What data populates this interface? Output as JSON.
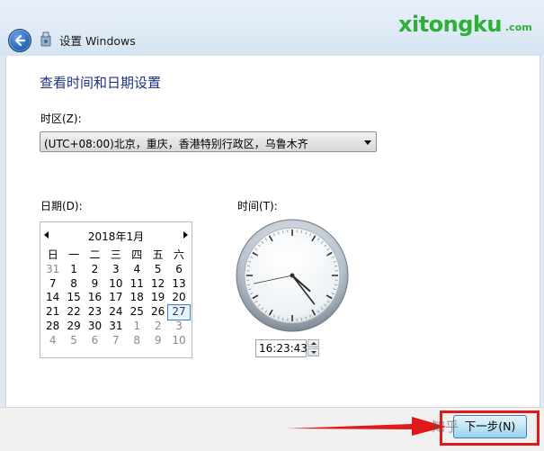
{
  "window": {
    "title": "设置 Windows"
  },
  "brand": {
    "name": "xitongku",
    "suffix": ".com",
    "color": "#2fae3a"
  },
  "main": {
    "heading": "查看时间和日期设置",
    "timezone": {
      "label": "时区(Z):",
      "value": "(UTC+08:00)北京，重庆，香港特别行政区，乌鲁木齐"
    },
    "date_label": "日期(D):",
    "time_label": "时间(T):",
    "calendar": {
      "month": "2018年1月",
      "weekdays": [
        "日",
        "一",
        "二",
        "三",
        "四",
        "五",
        "六"
      ],
      "weeks": [
        [
          "31",
          "1",
          "2",
          "3",
          "4",
          "5",
          "6"
        ],
        [
          "7",
          "8",
          "9",
          "10",
          "11",
          "12",
          "13"
        ],
        [
          "14",
          "15",
          "16",
          "17",
          "18",
          "19",
          "20"
        ],
        [
          "21",
          "22",
          "23",
          "24",
          "25",
          "26",
          "27"
        ],
        [
          "28",
          "29",
          "30",
          "31",
          "1",
          "2",
          "3"
        ],
        [
          "4",
          "5",
          "6",
          "7",
          "8",
          "9",
          "10"
        ]
      ],
      "selected_day": "27"
    },
    "time_value": "16:23:43"
  },
  "footer": {
    "next_button": "下一步(N)",
    "watermark": "知乎"
  },
  "colors": {
    "accent": "#1e3287",
    "highlight_frame": "#e01a1a",
    "arrow": "#e01a1a"
  },
  "icons": [
    "back-arrow-icon",
    "setup-icon",
    "prev-month-icon",
    "next-month-icon",
    "spin-up-icon",
    "spin-down-icon",
    "dropdown-arrow-icon"
  ]
}
